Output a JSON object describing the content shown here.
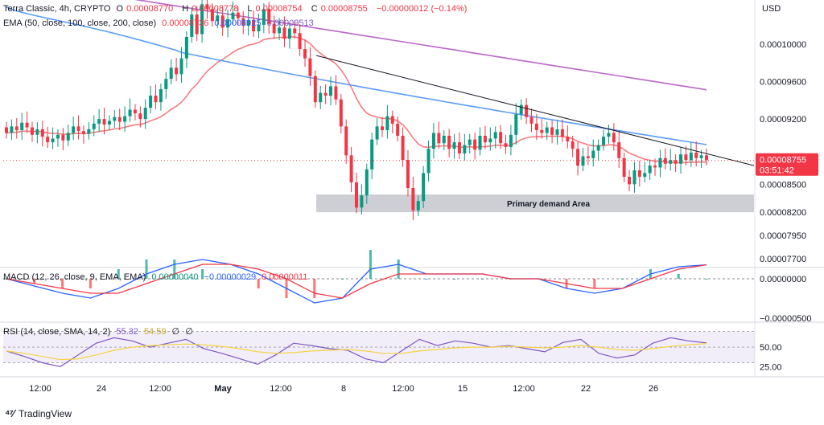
{
  "header": {
    "symbol_line": "Terra Classic, 4h, CRYPTO",
    "ohlc": {
      "o_label": "O",
      "o": "0.00008770",
      "h_label": "H",
      "h": "0.00008778",
      "l_label": "L",
      "l": "0.00008754",
      "c_label": "C",
      "c": "0.00008755",
      "change": "−0.00000012 (−0.14%)"
    },
    "ema_label": "EMA (50, close, 100, close, 200, close)",
    "ema_values": [
      "0.00008736",
      "0.00008925",
      "0.00009513"
    ]
  },
  "currency": "USD",
  "price_axis": {
    "ticks": [
      "0.00010000",
      "0.00009600",
      "0.00009200",
      "0.00008755",
      "0.00008500",
      "0.00008200",
      "0.00007950",
      "0.00007700"
    ],
    "last_price": "0.00008755",
    "countdown": "03:51:42"
  },
  "annotation": {
    "demand_label": "Primary demand Area"
  },
  "macd": {
    "label": "MACD (12, 26, close, 9, EMA, EMA)",
    "values": [
      "0.00000040",
      "−0.00000029",
      "0.00000011"
    ],
    "ticks": [
      "0.00000000",
      "−0.00000500"
    ]
  },
  "rsi": {
    "label": "RSI (14, close, SMA, 14, 2)",
    "values": [
      "55.32",
      "54.59",
      "∅",
      "∅"
    ],
    "ticks": [
      "50.00",
      "25.00"
    ]
  },
  "time_axis": {
    "ticks": [
      "12:00",
      "24",
      "12:00",
      "May",
      "12:00",
      "8",
      "12:00",
      "15",
      "12:00",
      "22",
      "26"
    ]
  },
  "footer": {
    "brand": "TradingView"
  },
  "colors": {
    "up": "#089981",
    "down": "#f23645",
    "ema50": "#f77c80",
    "ema100": "#5b9cf6",
    "ema200": "#ba68c8",
    "trendline": "#131722",
    "demand": "#b2b5be",
    "macd": "#2962ff",
    "signal": "#f23645",
    "rsi": "#7e57c2",
    "rsi_ma": "#f5d343"
  },
  "chart_data": [
    {
      "type": "candlestick",
      "title": "Terra Classic, 4h, CRYPTO",
      "ylabel": "USD",
      "ylim": [
        7.65e-05,
        0.0001045
      ],
      "x_ticks": [
        "12:00",
        "24",
        "12:00",
        "May",
        "12:00",
        "8",
        "12:00",
        "15",
        "12:00",
        "22",
        "26"
      ],
      "candles_close": [
        9.05e-05,
        9.12e-05,
        9.08e-05,
        9.16e-05,
        9.11e-05,
        9.03e-05,
        9.09e-05,
        9.01e-05,
        8.95e-05,
        8.99e-05,
        9.03e-05,
        8.97e-05,
        9.05e-05,
        9.12e-05,
        9.07e-05,
        9.04e-05,
        9.09e-05,
        9.15e-05,
        9.2e-05,
        9.14e-05,
        9.18e-05,
        9.22e-05,
        9.17e-05,
        9.23e-05,
        9.3e-05,
        9.26e-05,
        9.2e-05,
        9.32e-05,
        9.45e-05,
        9.38e-05,
        9.52e-05,
        9.63e-05,
        9.75e-05,
        9.68e-05,
        9.85e-05,
        0.0001008,
        0.0001032,
        0.0001011,
        0.0001043,
        0.0001038,
        0.0001025,
        0.0001031,
        0.0001018,
        0.0001027,
        0.0001034,
        0.0001028,
        0.000102,
        0.0001026,
        0.0001014,
        0.0001021,
        0.0001038,
        0.0001022,
        0.0001012,
        0.0001018,
        0.0001006,
        0.0001017,
        0.0001012,
        9.95e-05,
        9.85e-05,
        9.66e-05,
        9.38e-05,
        9.48e-05,
        9.45e-05,
        9.55e-05,
        9.41e-05,
        9.12e-05,
        8.81e-05,
        8.52e-05,
        8.25e-05,
        8.38e-05,
        8.66e-05,
        8.98e-05,
        9.12e-05,
        9.08e-05,
        9.23e-05,
        9.15e-05,
        9.02e-05,
        8.76e-05,
        8.46e-05,
        8.22e-05,
        8.32e-05,
        8.62e-05,
        8.88e-05,
        9.05e-05,
        8.94e-05,
        9.02e-05,
        8.88e-05,
        8.95e-05,
        8.83e-05,
        8.92e-05,
        8.98e-05,
        8.87e-05,
        9.02e-05,
        8.95e-05,
        8.99e-05,
        9.06e-05,
        8.94e-05,
        8.9e-05,
        9.03e-05,
        9.25e-05,
        9.35e-05,
        9.22e-05,
        9.15e-05,
        9.08e-05,
        9.05e-05,
        9.11e-05,
        9.03e-05,
        9.09e-05,
        9.01e-05,
        8.96e-05,
        8.88e-05,
        8.7e-05,
        8.8e-05,
        8.78e-05,
        8.86e-05,
        8.92e-05,
        9.01e-05,
        9.05e-05,
        8.95e-05,
        8.78e-05,
        8.58e-05,
        8.5e-05,
        8.65e-05,
        8.58e-05,
        8.62e-05,
        8.7e-05,
        8.68e-05,
        8.78e-05,
        8.72e-05,
        8.76e-05,
        8.72e-05,
        8.82e-05,
        8.76e-05,
        8.84e-05,
        8.78e-05,
        8.81e-05,
        8.76e-05
      ],
      "ema50_end": 8.736e-05,
      "ema100_end": 8.925e-05,
      "ema200_end": 9.513e-05,
      "trendline": {
        "from_price": 9.88e-05,
        "to_price": 8.7e-05
      },
      "demand_zone": [
        8.2e-05,
        8.39e-05
      ]
    },
    {
      "type": "line",
      "title": "MACD (12, 26, close, 9, EMA, EMA)",
      "series": [
        {
          "name": "MACD",
          "values": [
            0.0,
            -1.5e-07,
            -3e-07,
            -4e-07,
            -2e-07,
            1e-07,
            3e-07,
            4e-07,
            3e-07,
            1e-07,
            -2e-07,
            -5e-07,
            -4e-07,
            2e-07,
            3e-07,
            1e-07,
            1e-07,
            1e-07,
            0.0,
            0.0,
            -2e-07,
            -3e-07,
            -2e-07,
            1e-07,
            2.5e-07,
            2.9e-07
          ]
        },
        {
          "name": "Signal",
          "values": [
            0.0,
            -1e-07,
            -2e-07,
            -3e-07,
            -3e-07,
            -1e-07,
            1e-07,
            3e-07,
            3e-07,
            2e-07,
            0.0,
            -3e-07,
            -4e-07,
            -1e-07,
            1e-07,
            1e-07,
            1e-07,
            1e-07,
            0.0,
            0.0,
            -1e-07,
            -2e-07,
            -2e-07,
            0.0,
            2e-07,
            2.9e-07
          ]
        }
      ]
    },
    {
      "type": "line",
      "title": "RSI (14, close, SMA, 14, 2)",
      "ylim": [
        15,
        80
      ],
      "series": [
        {
          "name": "RSI",
          "values": [
            45,
            38,
            30,
            25,
            40,
            55,
            62,
            58,
            50,
            55,
            60,
            48,
            42,
            35,
            28,
            40,
            55,
            52,
            48,
            46,
            35,
            30,
            45,
            60,
            52,
            58,
            55,
            50,
            52,
            48,
            44,
            56,
            60,
            42,
            36,
            40,
            55,
            62,
            58,
            55.32
          ]
        },
        {
          "name": "RSI-based MA",
          "values": [
            45,
            42,
            38,
            34,
            35,
            40,
            46,
            50,
            52,
            53,
            54,
            53,
            51,
            48,
            44,
            42,
            43,
            45,
            46,
            47,
            45,
            42,
            42,
            45,
            47,
            49,
            50,
            50,
            51,
            50,
            49,
            50,
            52,
            50,
            47,
            46,
            48,
            51,
            53,
            54.59
          ]
        }
      ]
    }
  ]
}
